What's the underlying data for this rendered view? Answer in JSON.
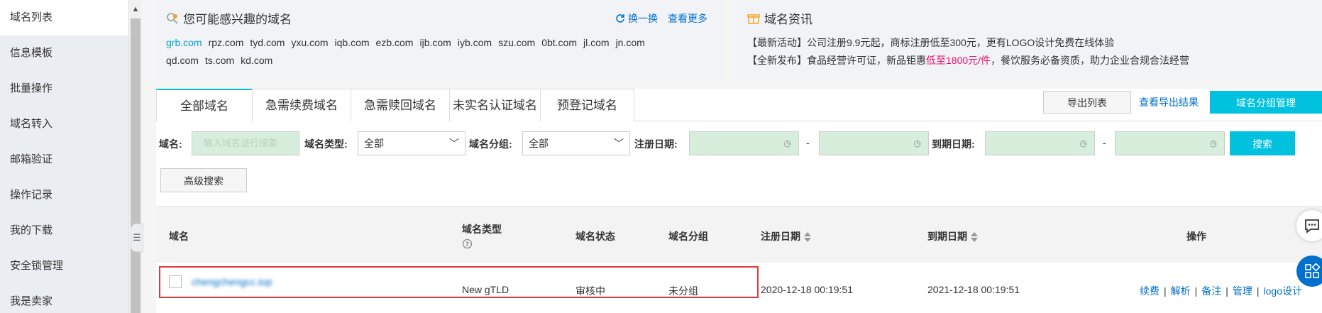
{
  "sidebar": {
    "items": [
      "域名列表",
      "信息模板",
      "批量操作",
      "域名转入",
      "邮箱验证",
      "操作记录",
      "我的下载",
      "安全锁管理",
      "我是卖家"
    ]
  },
  "interest": {
    "title": "您可能感兴趣的域名",
    "refresh": "换一换",
    "more": "查看更多",
    "domains": [
      "grb.com",
      "rpz.com",
      "tyd.com",
      "yxu.com",
      "iqb.com",
      "ezb.com",
      "ijb.com",
      "iyb.com",
      "szu.com",
      "0bt.com",
      "jl.com",
      "jn.com",
      "qd.com",
      "ts.com",
      "kd.com"
    ]
  },
  "news": {
    "title": "域名资讯",
    "line1": "【最新活动】公司注册9.9元起，商标注册低至300元，更有LOGO设计免费在线体验",
    "line2_a": "【全新发布】食品经营许可证，新品钜惠",
    "line2_red": "低至1800元/件",
    "line2_b": "，餐饮服务必备资质，助力企业合规合法经营"
  },
  "tabs": [
    "全部域名",
    "急需续费域名",
    "急需赎回域名",
    "未实名认证域名",
    "预登记域名"
  ],
  "actions": {
    "export": "导出列表",
    "view_export": "查看导出结果",
    "group_manage": "域名分组管理"
  },
  "filters": {
    "domain_label": "域名:",
    "domain_placeholder": "输入域名进行搜索",
    "type_label": "域名类型:",
    "type_value": "全部",
    "group_label": "域名分组:",
    "group_value": "全部",
    "reg_label": "注册日期:",
    "exp_label": "到期日期:",
    "dash": "-",
    "search": "搜索",
    "advanced": "高级搜索"
  },
  "table": {
    "headers": {
      "domain": "域名",
      "type": "域名类型",
      "status": "域名状态",
      "group": "域名分组",
      "reg": "注册日期",
      "exp": "到期日期",
      "ops": "操作"
    },
    "row": {
      "domain": "chengchengcc.top",
      "type": "New gTLD",
      "status": "审核中",
      "group": "未分组",
      "reg": "2020-12-18 00:19:51",
      "exp": "2021-12-18 00:19:51",
      "ops": [
        "续费",
        "解析",
        "备注",
        "管理",
        "logo设计"
      ]
    }
  }
}
